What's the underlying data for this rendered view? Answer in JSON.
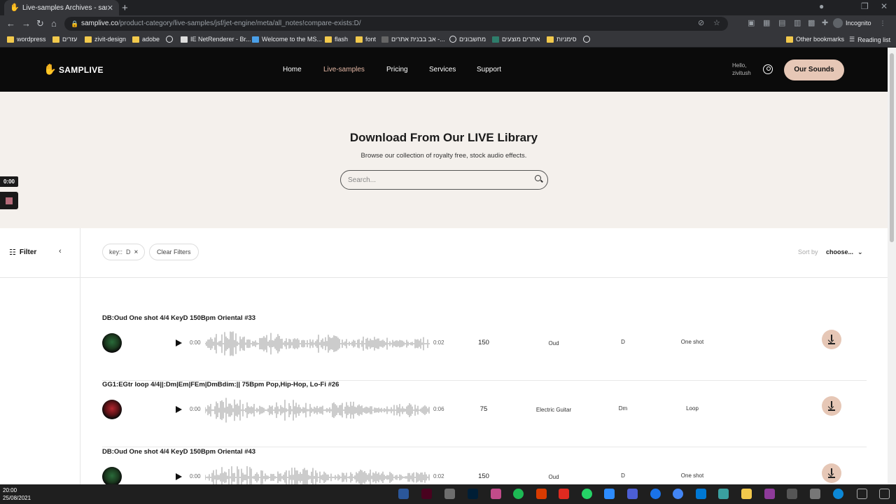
{
  "browser": {
    "tab_title": "Live-samples Archives - samplive",
    "url_host": "samplive.co",
    "url_path": "/product-category/live-samples/jsf/jet-engine/meta/all_notes!compare-exists:D/",
    "incognito_label": "Incognito",
    "bookmarks": [
      "wordpress",
      "עזרים",
      "zivit-design",
      "adobe",
      "IE NetRenderer - Br...",
      "Welcome to the MS...",
      "flash",
      "font",
      "אב בבנית אתרים -...",
      "מחשבונים",
      "אתרים מוצעים",
      "סימניות"
    ],
    "other_bookmarks": "Other bookmarks",
    "reading_list": "Reading list"
  },
  "site": {
    "logo_text": "SAMPLIVE",
    "nav": [
      "Home",
      "Live-samples",
      "Pricing",
      "Services",
      "Support"
    ],
    "active_nav": "Live-samples",
    "hello_line1": "Hello,",
    "hello_line2": "zivitush",
    "cta": "Our Sounds"
  },
  "hero": {
    "title": "Download From Our LIVE Library",
    "subtitle": "Browse our collection of royalty free, stock audio effects.",
    "search_placeholder": "Search..."
  },
  "player": {
    "time": "0:00"
  },
  "filters": {
    "label": "Filter",
    "chip_key": "key::",
    "chip_value": "D",
    "clear": "Clear Filters",
    "sort_label": "Sort by",
    "sort_value": "choose..."
  },
  "samples": [
    {
      "title": "DB:Oud One shot 4/4 KeyD 150Bpm Oriental #33",
      "start": "0:00",
      "end": "0:02",
      "bpm": "150",
      "instrument": "Oud",
      "key": "D",
      "type": "One shot"
    },
    {
      "title": "GG1:EGtr loop 4/4||:Dm|Em|FEm|DmBdim:|| 75Bpm Pop,Hip-Hop, Lo-Fi #26",
      "start": "0:00",
      "end": "0:06",
      "bpm": "75",
      "instrument": "Electric Guitar",
      "key": "Dm",
      "type": "Loop"
    },
    {
      "title": "DB:Oud One shot 4/4 KeyD 150Bpm Oriental #43",
      "start": "0:00",
      "end": "0:02",
      "bpm": "150",
      "instrument": "Oud",
      "key": "D",
      "type": "One shot"
    }
  ],
  "taskbar": {
    "time": "20:00",
    "date": "25/08/2021"
  }
}
